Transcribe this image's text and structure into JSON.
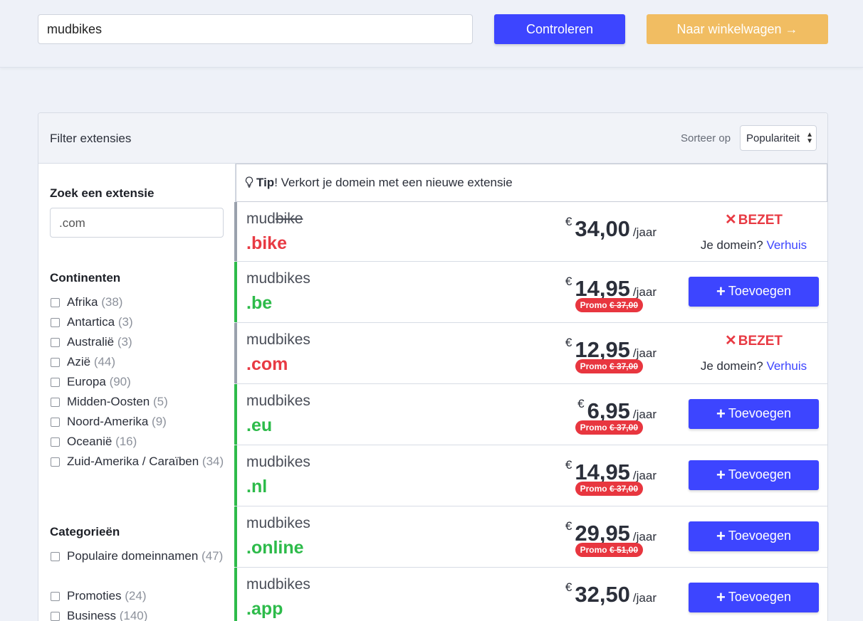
{
  "header": {
    "search_value": "mudbikes",
    "check_label": "Controleren",
    "cart_label": "Naar winkelwagen →"
  },
  "panel": {
    "filter_title": "Filter extensies",
    "sort_label": "Sorteer op",
    "sort_value": "Populariteit"
  },
  "sidebar": {
    "search_heading": "Zoek een extensie",
    "search_placeholder": ".com",
    "continents_heading": "Continenten",
    "continents": [
      {
        "label": "Afrika",
        "count": "(38)"
      },
      {
        "label": "Antartica",
        "count": "(3)"
      },
      {
        "label": "Australië",
        "count": "(3)"
      },
      {
        "label": "Azië",
        "count": "(44)"
      },
      {
        "label": "Europa",
        "count": "(90)"
      },
      {
        "label": "Midden-Oosten",
        "count": "(5)"
      },
      {
        "label": "Noord-Amerika",
        "count": "(9)"
      },
      {
        "label": "Oceanië",
        "count": "(16)"
      },
      {
        "label": "Zuid-Amerika / Caraïben",
        "count": "(34)"
      }
    ],
    "categories_heading": "Categorieën",
    "categories": [
      {
        "label": "Populaire domeinnamen",
        "count": "(47)"
      },
      {
        "label": "Promoties",
        "count": "(24)"
      },
      {
        "label": "Business",
        "count": "(140)"
      }
    ]
  },
  "tip": {
    "strong": "Tip",
    "text": "! Verkort je domein met een nieuwe extensie"
  },
  "results": [
    {
      "name_plain": "mud",
      "name_struck": "bike",
      "ext": ".bike",
      "available": false,
      "currency": "€",
      "price": "34,00",
      "per": "/jaar",
      "promo": "",
      "taken_label": "BEZET",
      "taken_q": "Je domein?",
      "taken_link": "Verhuis"
    },
    {
      "name_plain": "mudbikes",
      "name_struck": "",
      "ext": ".be",
      "available": true,
      "currency": "€",
      "price": "14,95",
      "per": "/jaar",
      "promo_prefix": "Promo",
      "promo_old": "€ 37,00",
      "add_label": "Toevoegen"
    },
    {
      "name_plain": "mudbikes",
      "name_struck": "",
      "ext": ".com",
      "available": false,
      "currency": "€",
      "price": "12,95",
      "per": "/jaar",
      "promo_prefix": "Promo",
      "promo_old": "€ 37,00",
      "taken_label": "BEZET",
      "taken_q": "Je domein?",
      "taken_link": "Verhuis"
    },
    {
      "name_plain": "mudbikes",
      "name_struck": "",
      "ext": ".eu",
      "available": true,
      "currency": "€",
      "price": "6,95",
      "per": "/jaar",
      "promo_prefix": "Promo",
      "promo_old": "€ 37,00",
      "add_label": "Toevoegen"
    },
    {
      "name_plain": "mudbikes",
      "name_struck": "",
      "ext": ".nl",
      "available": true,
      "currency": "€",
      "price": "14,95",
      "per": "/jaar",
      "promo_prefix": "Promo",
      "promo_old": "€ 37,00",
      "add_label": "Toevoegen"
    },
    {
      "name_plain": "mudbikes",
      "name_struck": "",
      "ext": ".online",
      "available": true,
      "currency": "€",
      "price": "29,95",
      "per": "/jaar",
      "promo_prefix": "Promo",
      "promo_old": "€ 51,00",
      "add_label": "Toevoegen"
    },
    {
      "name_plain": "mudbikes",
      "name_struck": "",
      "ext": ".app",
      "available": true,
      "currency": "€",
      "price": "32,50",
      "per": "/jaar",
      "promo_prefix": "",
      "promo_old": "",
      "add_label": "Toevoegen"
    }
  ],
  "colors": {
    "primary": "#3d45ff",
    "cart": "#f1bd62",
    "available": "#2dbb4a",
    "taken": "#e83a43"
  },
  "icons": {
    "tip": "lightbulb-icon",
    "add": "plus-icon",
    "taken": "x-icon",
    "cart_arrow": "arrow-right-icon",
    "sort": "sort-arrows-icon"
  }
}
